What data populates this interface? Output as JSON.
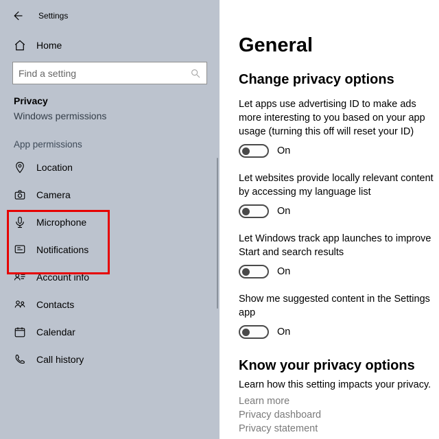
{
  "topbar": {
    "title": "Settings"
  },
  "sidebar": {
    "home_label": "Home",
    "search_placeholder": "Find a setting",
    "section_title": "Privacy",
    "section_sub_label": "Windows permissions",
    "group_label": "App permissions",
    "items": [
      {
        "label": "Location"
      },
      {
        "label": "Camera"
      },
      {
        "label": "Microphone"
      },
      {
        "label": "Notifications"
      },
      {
        "label": "Account info"
      },
      {
        "label": "Contacts"
      },
      {
        "label": "Calendar"
      },
      {
        "label": "Call history"
      }
    ]
  },
  "main": {
    "heading": "General",
    "subheading": "Change privacy options",
    "settings": [
      {
        "desc": "Let apps use advertising ID to make ads more interesting to you based on your app usage (turning this off will reset your ID)",
        "state_label": "On"
      },
      {
        "desc": "Let websites provide locally relevant content by accessing my language list",
        "state_label": "On"
      },
      {
        "desc": "Let Windows track app launches to improve Start and search results",
        "state_label": "On"
      },
      {
        "desc": "Show me suggested content in the Settings app",
        "state_label": "On"
      }
    ],
    "know": {
      "heading": "Know your privacy options",
      "desc": "Learn how this setting impacts your privacy.",
      "links": [
        "Learn more",
        "Privacy dashboard",
        "Privacy statement"
      ]
    }
  }
}
